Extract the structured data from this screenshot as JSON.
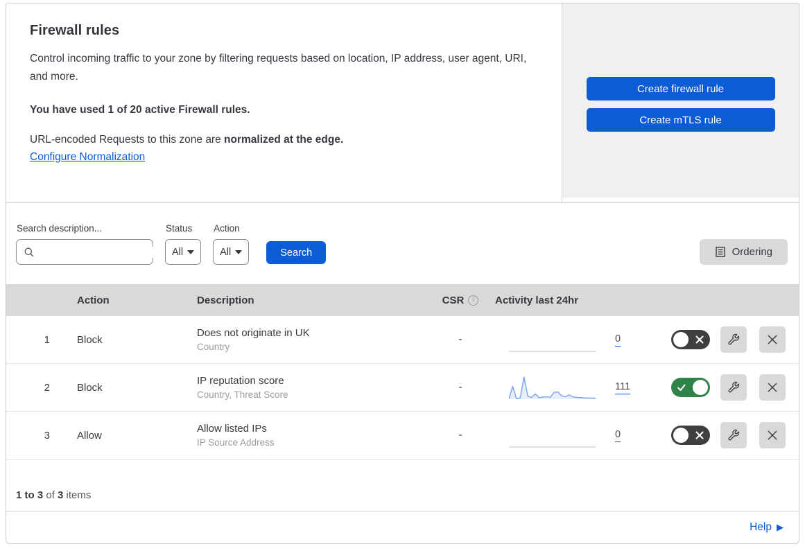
{
  "header": {
    "title": "Firewall rules",
    "description": "Control incoming traffic to your zone by filtering requests based on location, IP address, user agent, URI, and more.",
    "usage_notice": "You have used 1 of 20 active Firewall rules.",
    "normalization_text": "URL-encoded Requests to this zone are ",
    "normalization_bold": "normalized at the edge.",
    "normalization_link": "Configure Normalization"
  },
  "actions_panel": {
    "create_firewall_label": "Create firewall rule",
    "create_mtls_label": "Create mTLS rule"
  },
  "filters": {
    "search_label": "Search description...",
    "search_value": "",
    "status_label": "Status",
    "status_value": "All",
    "action_label": "Action",
    "action_value": "All",
    "search_button_label": "Search",
    "ordering_button_label": "Ordering"
  },
  "table": {
    "columns": {
      "action": "Action",
      "description": "Description",
      "csr": "CSR",
      "activity": "Activity last 24hr"
    },
    "rows": [
      {
        "num": "1",
        "action": "Block",
        "title": "Does not originate in UK",
        "subtitle": "Country",
        "csr": "-",
        "activity_count": "0",
        "enabled": false,
        "sparkline": null
      },
      {
        "num": "2",
        "action": "Block",
        "title": "IP reputation score",
        "subtitle": "Country, Threat Score",
        "csr": "-",
        "activity_count": "111",
        "enabled": true,
        "sparkline": [
          1,
          58,
          2,
          6,
          100,
          14,
          8,
          24,
          7,
          10,
          11,
          9,
          31,
          33,
          15,
          12,
          19,
          10,
          8,
          7,
          6,
          5,
          5,
          4
        ]
      },
      {
        "num": "3",
        "action": "Allow",
        "title": "Allow listed IPs",
        "subtitle": "IP Source Address",
        "csr": "-",
        "activity_count": "0",
        "enabled": false,
        "sparkline": null
      }
    ],
    "footer": {
      "range_bold": "1 to 3",
      "of_text": " of ",
      "total_bold": "3",
      "items_text": " items"
    }
  },
  "help": {
    "label": "Help",
    "arrow": "▶"
  },
  "icons": {
    "search": "magnifier",
    "ordering": "document-list",
    "csr_info": "info-circle-i",
    "toggle_on": "check",
    "toggle_off": "x",
    "edit_rule": "wrench",
    "delete_rule": "x",
    "dropdown": "caret-down"
  },
  "colors": {
    "accent_blue": "#0b5cd5",
    "toggle_on_green": "#2f8248",
    "toggle_off_gray": "#3f3f3f",
    "panel_gray": "#f0f0f0",
    "table_header_gray": "#d9d9d9",
    "sparkline_blue": "#7da7ea",
    "subtitle_gray": "#9b9b9b"
  }
}
